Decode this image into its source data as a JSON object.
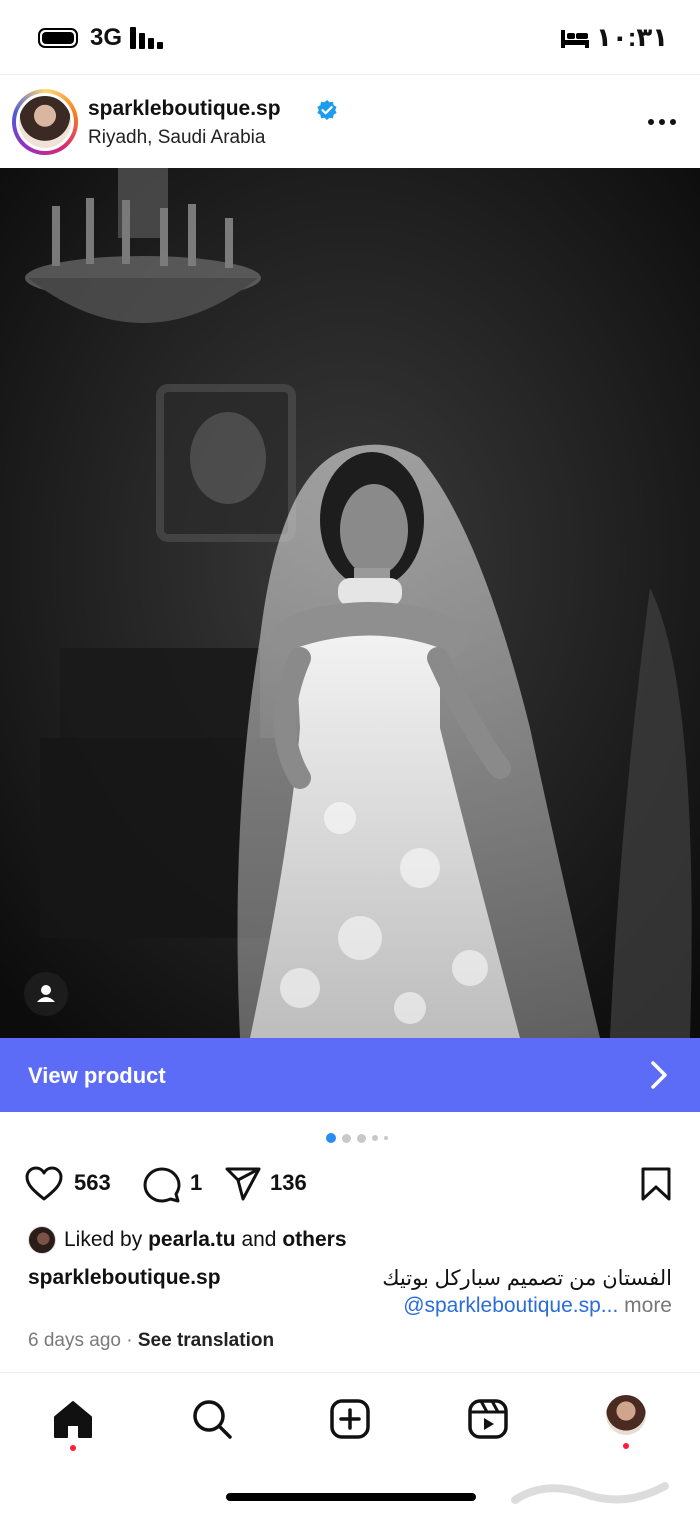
{
  "status_bar": {
    "network": "3G",
    "time": "١٠:٣١"
  },
  "post": {
    "username": "sparkleboutique.sp",
    "verified": true,
    "location": "Riyadh, Saudi Arabia",
    "image_description_icon": "bride-in-veil-photo",
    "carousel_count": 5,
    "carousel_active_index": 0
  },
  "product_bar": {
    "label": "View product",
    "color": "#5c6cf7"
  },
  "actions": {
    "likes": "563",
    "comments": "1",
    "shares": "136"
  },
  "liked_by": {
    "prefix": "Liked by",
    "user": "pearla.tu",
    "and": "and",
    "others": "others"
  },
  "caption": {
    "username": "sparkleboutique.sp",
    "text": "الفستان من تصميم سباركل بوتيك",
    "mention": "@sparkleboutique.sp...",
    "more": "more"
  },
  "meta": {
    "age": "6 days ago",
    "separator": "·",
    "translate": "See translation"
  },
  "colors": {
    "accent": "#5c6cf7",
    "notification": "#ff1b3a",
    "mention": "#2a6cd8",
    "verified": "#1d9bf0"
  }
}
